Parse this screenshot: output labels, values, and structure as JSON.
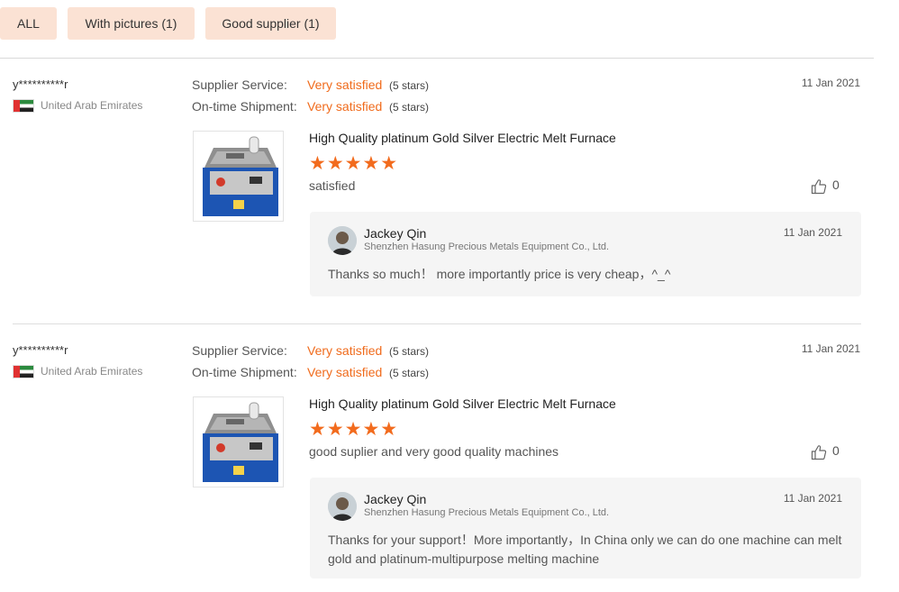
{
  "filters": [
    {
      "label": "ALL"
    },
    {
      "label": "With pictures (1)"
    },
    {
      "label": "Good supplier (1)"
    }
  ],
  "reviews": [
    {
      "buyer": "y**********r",
      "country": "United Arab Emirates",
      "ratings": [
        {
          "label": "Supplier Service:",
          "value": "Very satisfied",
          "stars": "(5 stars)"
        },
        {
          "label": "On-time Shipment:",
          "value": "Very satisfied",
          "stars": "(5 stars)"
        }
      ],
      "date": "11 Jan 2021",
      "product": "High Quality platinum Gold Silver Electric Melt Furnace",
      "stars": "★★★★★",
      "comment": "satisfied",
      "likes": "0",
      "reply": {
        "name": "Jackey Qin",
        "company": "Shenzhen Hasung Precious Metals Equipment Co., Ltd.",
        "date": "11 Jan 2021",
        "text": "Thanks so much！  more importantly price is very cheap，^_^"
      }
    },
    {
      "buyer": "y**********r",
      "country": "United Arab Emirates",
      "ratings": [
        {
          "label": "Supplier Service:",
          "value": "Very satisfied",
          "stars": "(5 stars)"
        },
        {
          "label": "On-time Shipment:",
          "value": "Very satisfied",
          "stars": "(5 stars)"
        }
      ],
      "date": "11 Jan 2021",
      "product": "High Quality platinum Gold Silver Electric Melt Furnace",
      "stars": "★★★★★",
      "comment": "good suplier and very good quality machines",
      "likes": "0",
      "reply": {
        "name": "Jackey Qin",
        "company": "Shenzhen Hasung Precious Metals Equipment Co., Ltd.",
        "date": "11 Jan 2021",
        "text": "Thanks for your support！More importantly，In China only we can do one machine can melt gold and platinum-multipurpose melting machine"
      }
    }
  ],
  "colors": {
    "accent": "#f06b1c",
    "chip_bg": "#fbe2d4",
    "reply_bg": "#f5f5f5"
  },
  "icons": {
    "like": "thumbs-up-icon",
    "flag": "uae-flag-icon",
    "avatar": "avatar"
  }
}
